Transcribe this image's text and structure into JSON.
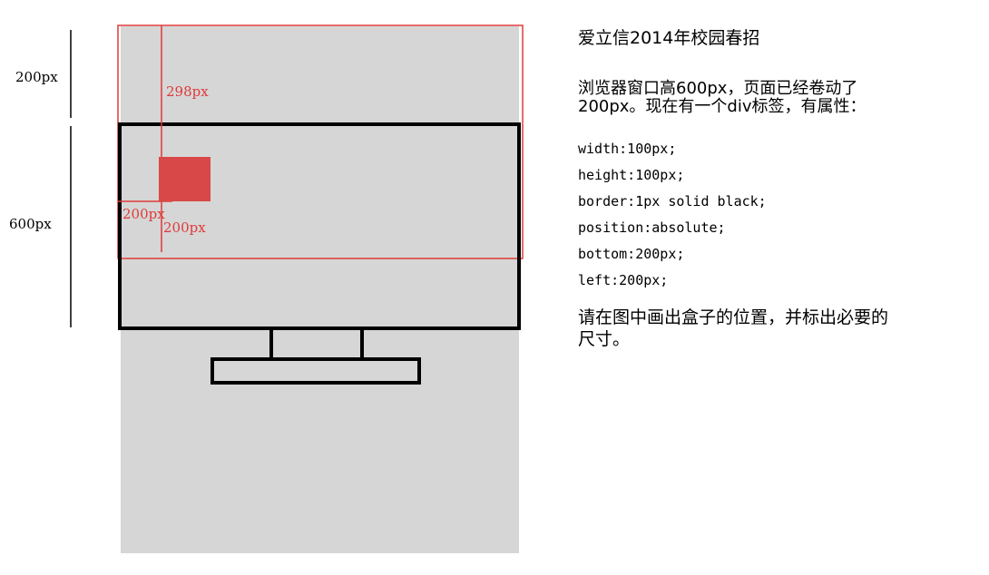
{
  "colors": {
    "page_gray": "#d6d6d6",
    "outline": "#000000",
    "annotation_red": "#e03a3a",
    "box_fill": "#d94848"
  },
  "diagram": {
    "left_dims": {
      "scrolled_label": "200px",
      "window_label": "600px"
    },
    "annotations": {
      "vertical_offset_label": "298px",
      "horizontal_offset_label": "200px",
      "bottom_offset_label": "200px"
    }
  },
  "panel": {
    "title": "爱立信2014年校园春招",
    "description": "浏览器窗口高600px，页面已经卷动了\n200px。现在有一个div标签，有属性：",
    "properties": [
      "width:100px;",
      "height:100px;",
      "border:1px solid black;",
      "position:absolute;",
      "bottom:200px;",
      "left:200px;"
    ],
    "question": "请在图中画出盒子的位置，并标出必要的\n尺寸。"
  }
}
